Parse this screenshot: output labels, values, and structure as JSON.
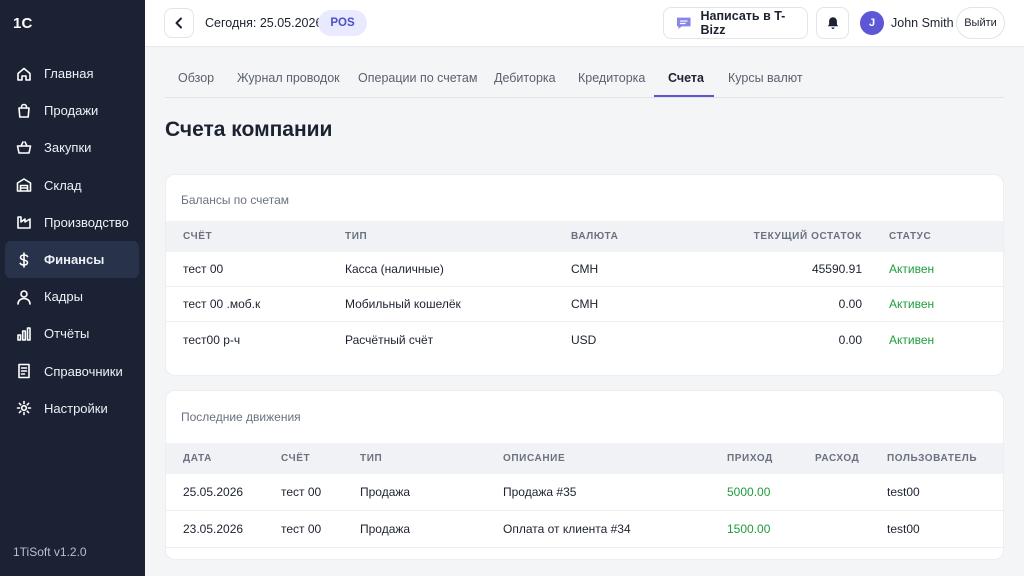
{
  "sidebar": {
    "logo": "1C",
    "items": [
      {
        "label": "Главная",
        "icon": "home-icon"
      },
      {
        "label": "Продажи",
        "icon": "shopping-bag-icon"
      },
      {
        "label": "Закупки",
        "icon": "basket-icon"
      },
      {
        "label": "Склад",
        "icon": "warehouse-icon"
      },
      {
        "label": "Производство",
        "icon": "factory-icon"
      },
      {
        "label": "Финансы",
        "icon": "dollar-icon",
        "active": true
      },
      {
        "label": "Кадры",
        "icon": "user-icon"
      },
      {
        "label": "Отчёты",
        "icon": "bar-chart-icon"
      },
      {
        "label": "Справочники",
        "icon": "book-icon"
      },
      {
        "label": "Настройки",
        "icon": "gear-icon"
      }
    ],
    "version": "1TiSoft v1.2.0"
  },
  "header": {
    "today": "Сегодня: 25.05.2026",
    "pos_badge": "POS",
    "write_button": "Написать в T-Bizz",
    "avatar_initial": "J",
    "username": "John Smith",
    "logout": "Выйти"
  },
  "tabs": [
    "Обзор",
    "Журнал проводок",
    "Операции по счетам",
    "Дебиторка",
    "Кредиторка",
    "Счета",
    "Курсы валют"
  ],
  "active_tab": "Счета",
  "page_title": "Счета компании",
  "balances": {
    "title": "Балансы по счетам",
    "columns": [
      "СЧЁТ",
      "ТИП",
      "ВАЛЮТА",
      "ТЕКУЩИЙ ОСТАТОК",
      "СТАТУС"
    ],
    "rows": [
      [
        "тест 00",
        "Касса (наличные)",
        "СМН",
        "45590.91",
        "Активен"
      ],
      [
        "тест 00 .моб.к",
        "Мобильный кошелёк",
        "СМН",
        "0.00",
        "Активен"
      ],
      [
        "тест00 р-ч",
        "Расчётный счёт",
        "USD",
        "0.00",
        "Активен"
      ]
    ]
  },
  "movements": {
    "title": "Последние движения",
    "columns": [
      "ДАТА",
      "СЧЁТ",
      "ТИП",
      "ОПИСАНИЕ",
      "ПРИХОД",
      "РАСХОД",
      "ПОЛЬЗОВАТЕЛЬ"
    ],
    "rows": [
      [
        "25.05.2026",
        "тест 00",
        "Продажа",
        "Продажа #35",
        "5000.00",
        "",
        "test00"
      ],
      [
        "23.05.2026",
        "тест 00",
        "Продажа",
        "Оплата от клиента #34",
        "1500.00",
        "",
        "test00"
      ]
    ]
  },
  "colors": {
    "sidebar_bg": "#1a2233",
    "accent": "#5d56d6",
    "status_green": "#1f9d3c"
  }
}
